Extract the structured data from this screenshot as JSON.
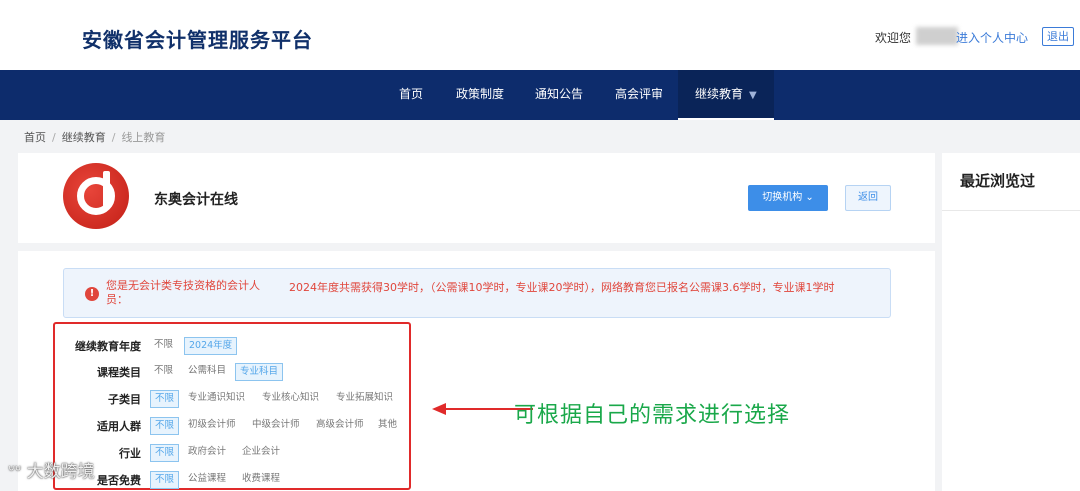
{
  "header": {
    "site_title": "安徽省会计管理服务平台",
    "welcome": "欢迎您",
    "user_center": "进入个人中心",
    "logout": "退出"
  },
  "nav": {
    "items": [
      "首页",
      "政策制度",
      "通知公告",
      "高会评审",
      "继续教育"
    ],
    "active": "继续教育"
  },
  "breadcrumb": [
    "首页",
    "继续教育",
    "线上教育"
  ],
  "org": {
    "name": "东奥会计在线",
    "switch_label": "切换机构",
    "back_label": "返回"
  },
  "recent": {
    "title": "最近浏览过"
  },
  "alert": {
    "left": "您是无会计类专技资格的会计人员：",
    "right": "2024年度共需获得30学时，（公需课10学时，专业课20学时），网络教育您已报名公需课3.6学时，专业课1学时"
  },
  "filters": [
    {
      "label": "继续教育年度",
      "options": [
        "不限",
        "2024年度"
      ],
      "selected": "2024年度"
    },
    {
      "label": "课程类目",
      "options": [
        "不限",
        "公需科目",
        "专业科目"
      ],
      "selected": "专业科目"
    },
    {
      "label": "子类目",
      "options": [
        "不限",
        "专业通识知识",
        "专业核心知识",
        "专业拓展知识"
      ],
      "selected": "不限"
    },
    {
      "label": "适用人群",
      "options": [
        "不限",
        "初级会计师",
        "中级会计师",
        "高级会计师",
        "其他"
      ],
      "selected": "不限"
    },
    {
      "label": "行业",
      "options": [
        "不限",
        "政府会计",
        "企业会计"
      ],
      "selected": "不限"
    },
    {
      "label": "是否免费",
      "options": [
        "不限",
        "公益课程",
        "收费课程"
      ],
      "selected": "不限"
    }
  ],
  "annotation": "可根据自己的需求进行选择",
  "watermark": "大数跨境"
}
